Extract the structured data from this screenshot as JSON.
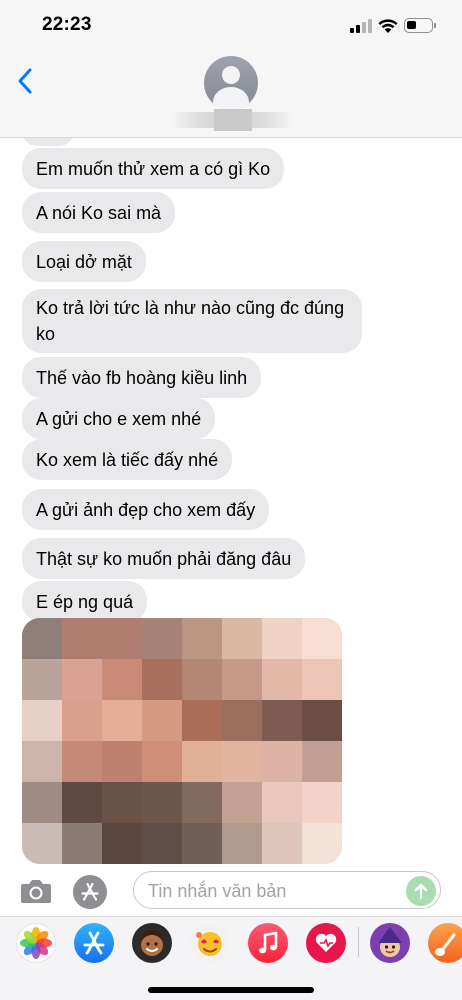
{
  "status_bar": {
    "time": "22:23",
    "icons": [
      "signal-icon",
      "wifi-icon",
      "battery-icon"
    ]
  },
  "header": {
    "back_icon": "chevron-left-icon",
    "contact_avatar": "person-icon"
  },
  "messages": [
    {
      "direction": "received",
      "text": "Em muốn thử xem a có gì Ko"
    },
    {
      "direction": "received",
      "text": "A nói Ko sai mà"
    },
    {
      "direction": "received",
      "text": "Loại dở mặt"
    },
    {
      "direction": "received",
      "text": "Ko trả lời tức là như nào cũng đc đúng ko"
    },
    {
      "direction": "received",
      "text": "Thế vào fb hoàng kiều linh"
    },
    {
      "direction": "received",
      "text": "A gửi cho e xem nhé"
    },
    {
      "direction": "received",
      "text": "Ko xem là tiếc đấy nhé"
    },
    {
      "direction": "received",
      "text": "A gửi ảnh đẹp cho xem đấy"
    },
    {
      "direction": "received",
      "text": "Thật sự ko muốn phải đăng đâu"
    },
    {
      "direction": "received",
      "text": "E ép ng quá"
    },
    {
      "direction": "received",
      "type": "image",
      "content": "pixelated-photo"
    }
  ],
  "input_bar": {
    "camera_icon": "camera-icon",
    "apps_icon": "app-store-icon",
    "placeholder": "Tin nhắn văn bản",
    "send_icon": "send-arrow-icon"
  },
  "app_tray": {
    "apps": [
      "photos-app-icon",
      "app-store-app-icon",
      "memoji-app-icon",
      "animoji-app-icon",
      "music-app-icon",
      "digital-touch-app-icon",
      "sticker-app-icon",
      "garageband-app-icon"
    ]
  },
  "colors": {
    "accent": "#007aff",
    "bubble_received": "#e9e9eb",
    "send_button": "#a9dcae",
    "background": "#ffffff"
  }
}
